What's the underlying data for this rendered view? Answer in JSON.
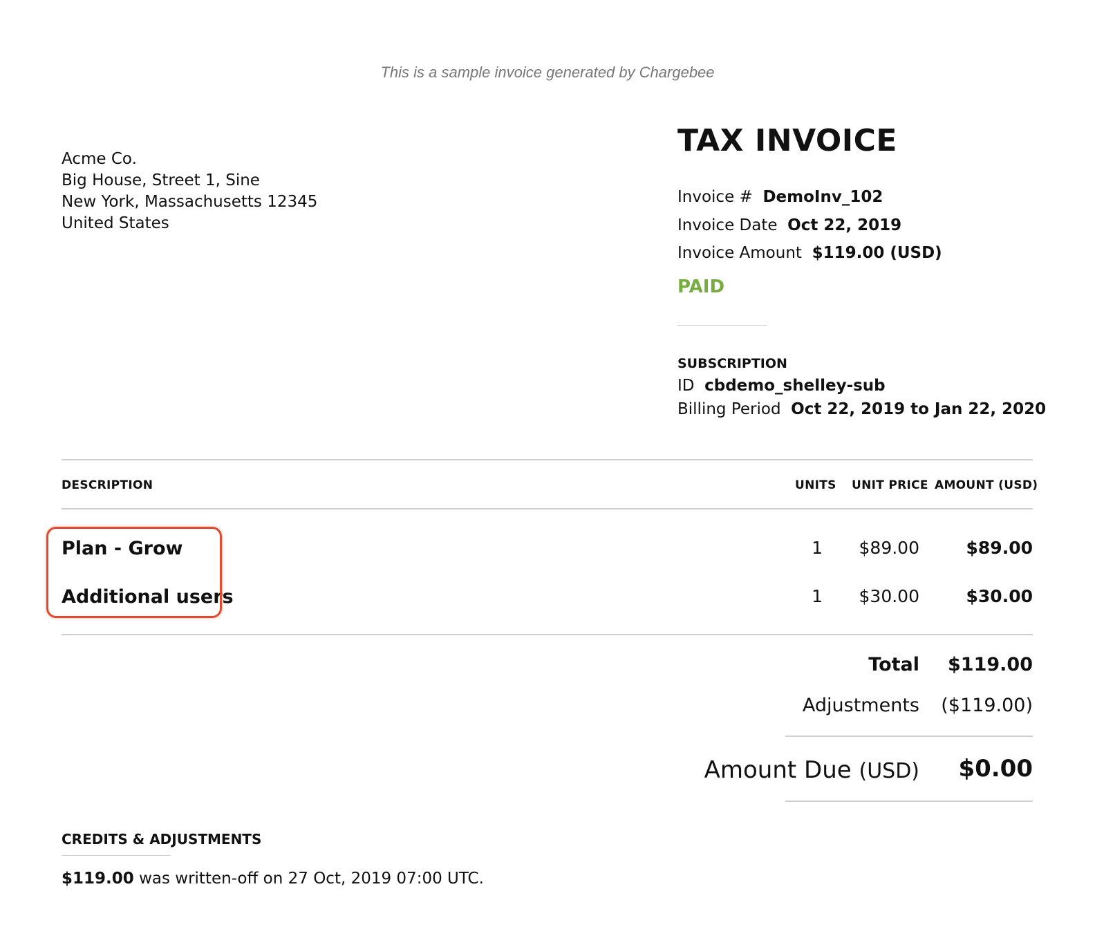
{
  "banner": "This is a sample invoice generated by Chargebee",
  "seller": {
    "name": "Acme Co.",
    "address_line1": "Big House, Street 1, Sine",
    "address_line2": "New York, Massachusetts 12345",
    "country": "United States"
  },
  "invoice": {
    "title": "TAX INVOICE",
    "number_label": "Invoice #",
    "number_value": "DemoInv_102",
    "date_label": "Invoice Date",
    "date_value": "Oct 22, 2019",
    "amount_label": "Invoice Amount",
    "amount_value": "$119.00 (USD)",
    "status": "PAID",
    "status_color": "#76ad3e"
  },
  "subscription": {
    "heading": "SUBSCRIPTION",
    "id_label": "ID",
    "id_value": "cbdemo_shelley-sub",
    "period_label": "Billing Period",
    "period_value": "Oct 22, 2019 to Jan 22, 2020"
  },
  "table": {
    "headers": {
      "description": "DESCRIPTION",
      "units": "UNITS",
      "unit_price": "UNIT PRICE",
      "amount": "AMOUNT (USD)"
    },
    "rows": [
      {
        "description": "Plan - Grow",
        "units": "1",
        "unit_price": "$89.00",
        "amount": "$89.00"
      },
      {
        "description": "Additional users",
        "units": "1",
        "unit_price": "$30.00",
        "amount": "$30.00"
      }
    ]
  },
  "totals": {
    "total_label": "Total",
    "total_value": "$119.00",
    "adjustments_label": "Adjustments",
    "adjustments_value": "($119.00)",
    "amount_due_label": "Amount Due",
    "amount_due_currency": "(USD)",
    "amount_due_value": "$0.00"
  },
  "credits": {
    "heading": "CREDITS & ADJUSTMENTS",
    "amount": "$119.00",
    "text": " was written-off on 27 Oct, 2019 07:00 UTC."
  },
  "annotation_color": "#e04a2e"
}
